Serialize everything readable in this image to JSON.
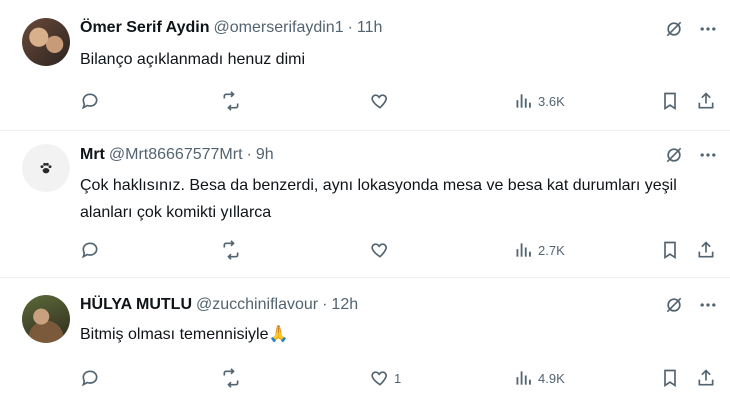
{
  "colors": {
    "text": "#0f1419",
    "muted": "#536471",
    "divider": "#eff3f4"
  },
  "tweets": [
    {
      "name": "Ömer Serif Aydin",
      "handle": "@omerserifaydin1",
      "separator": "·",
      "time": "11h",
      "text": "Bilanço açıklanmadı henuz dimi",
      "likes": "",
      "views": "3.6K"
    },
    {
      "name": "Mrt",
      "handle": "@Mrt86667577Mrt",
      "separator": "·",
      "time": "9h",
      "text": "Çok haklısınız. Besa da benzerdi, aynı lokasyonda mesa ve besa kat durumları yeşil alanları çok komikti yıllarca",
      "likes": "",
      "views": "2.7K"
    },
    {
      "name": "HÜLYA MUTLU",
      "handle": "@zucchiniflavour",
      "separator": "·",
      "time": "12h",
      "text": "Bitmiş olması temennisiyle",
      "emoji": "🙏",
      "likes": "1",
      "views": "4.9K"
    }
  ]
}
